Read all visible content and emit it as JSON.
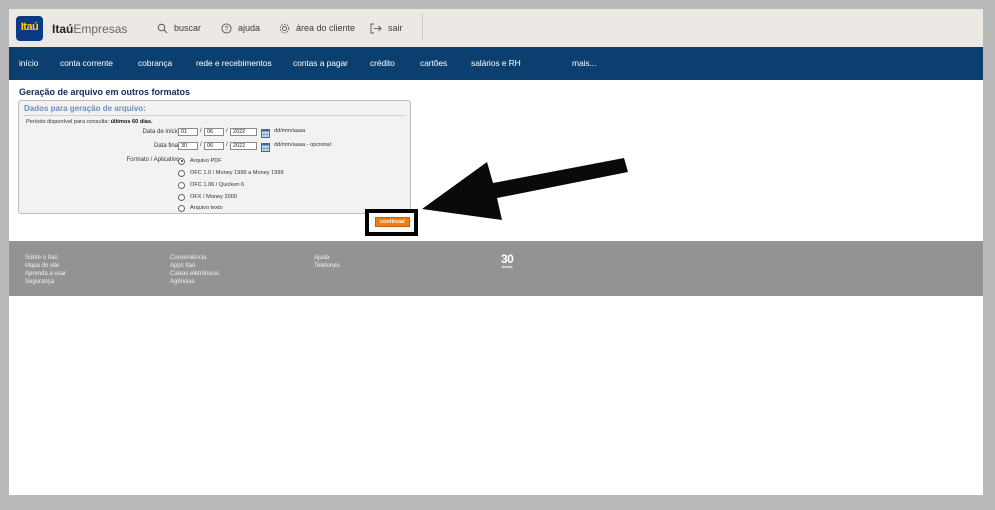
{
  "header": {
    "logo_text": "Itaú",
    "brand_bold": "Itaú",
    "brand_light": "Empresas",
    "links": [
      {
        "label": "buscar",
        "icon": "search-icon"
      },
      {
        "label": "ajuda",
        "icon": "help-icon"
      },
      {
        "label": "área do cliente",
        "icon": "gear-icon"
      },
      {
        "label": "sair",
        "icon": "exit-icon"
      }
    ]
  },
  "nav": {
    "items": [
      "início",
      "conta corrente",
      "cobrança",
      "rede e recebimentos",
      "contas a pagar",
      "crédito",
      "cartões",
      "salários e RH",
      "mais..."
    ]
  },
  "page": {
    "title": "Geração de arquivo em outros formatos",
    "panel_title": "Dados para geração de arquivo:",
    "period_text": "Período disponível para consulta:",
    "period_bold": "últimos 60 dias.",
    "start_label": "Data de início:",
    "start_day": "01",
    "start_month": "06",
    "start_year": "2022",
    "start_hint": "dd/mm/aaaa",
    "end_label": "Data final:",
    "end_day": "30",
    "end_month": "06",
    "end_year": "2022",
    "end_hint": "dd/mm/aaaa - opcional",
    "slash": "/",
    "format_label": "Formato / Aplicativo:",
    "formats": [
      {
        "label": "Arquivo PDF",
        "checked": true
      },
      {
        "label": "OFC 1.0 / Money 1995 a Money 1999",
        "checked": false
      },
      {
        "label": "OFC 1.06 / Quicken 6",
        "checked": false
      },
      {
        "label": "OFX / Money 2000",
        "checked": false
      },
      {
        "label": "Arquivo texto",
        "checked": false
      }
    ],
    "continue_label": "continuar"
  },
  "footer": {
    "col1": [
      "Sobre o Itaú",
      "Mapa do site",
      "Aprenda a usar",
      "Segurança"
    ],
    "col2": [
      "Conveniência",
      "Apps Itaú",
      "Caixas eletrônicos",
      "Agências"
    ],
    "col3": [
      "Ajuda",
      "Telefones"
    ],
    "badge_number": "30",
    "badge_label": "horas"
  },
  "colors": {
    "nav_bg": "#0b3f6f",
    "logo_bg": "#0b3a84",
    "logo_text": "#ffd200",
    "continue_bg": "#f07c14",
    "footer_bg": "#939393"
  }
}
